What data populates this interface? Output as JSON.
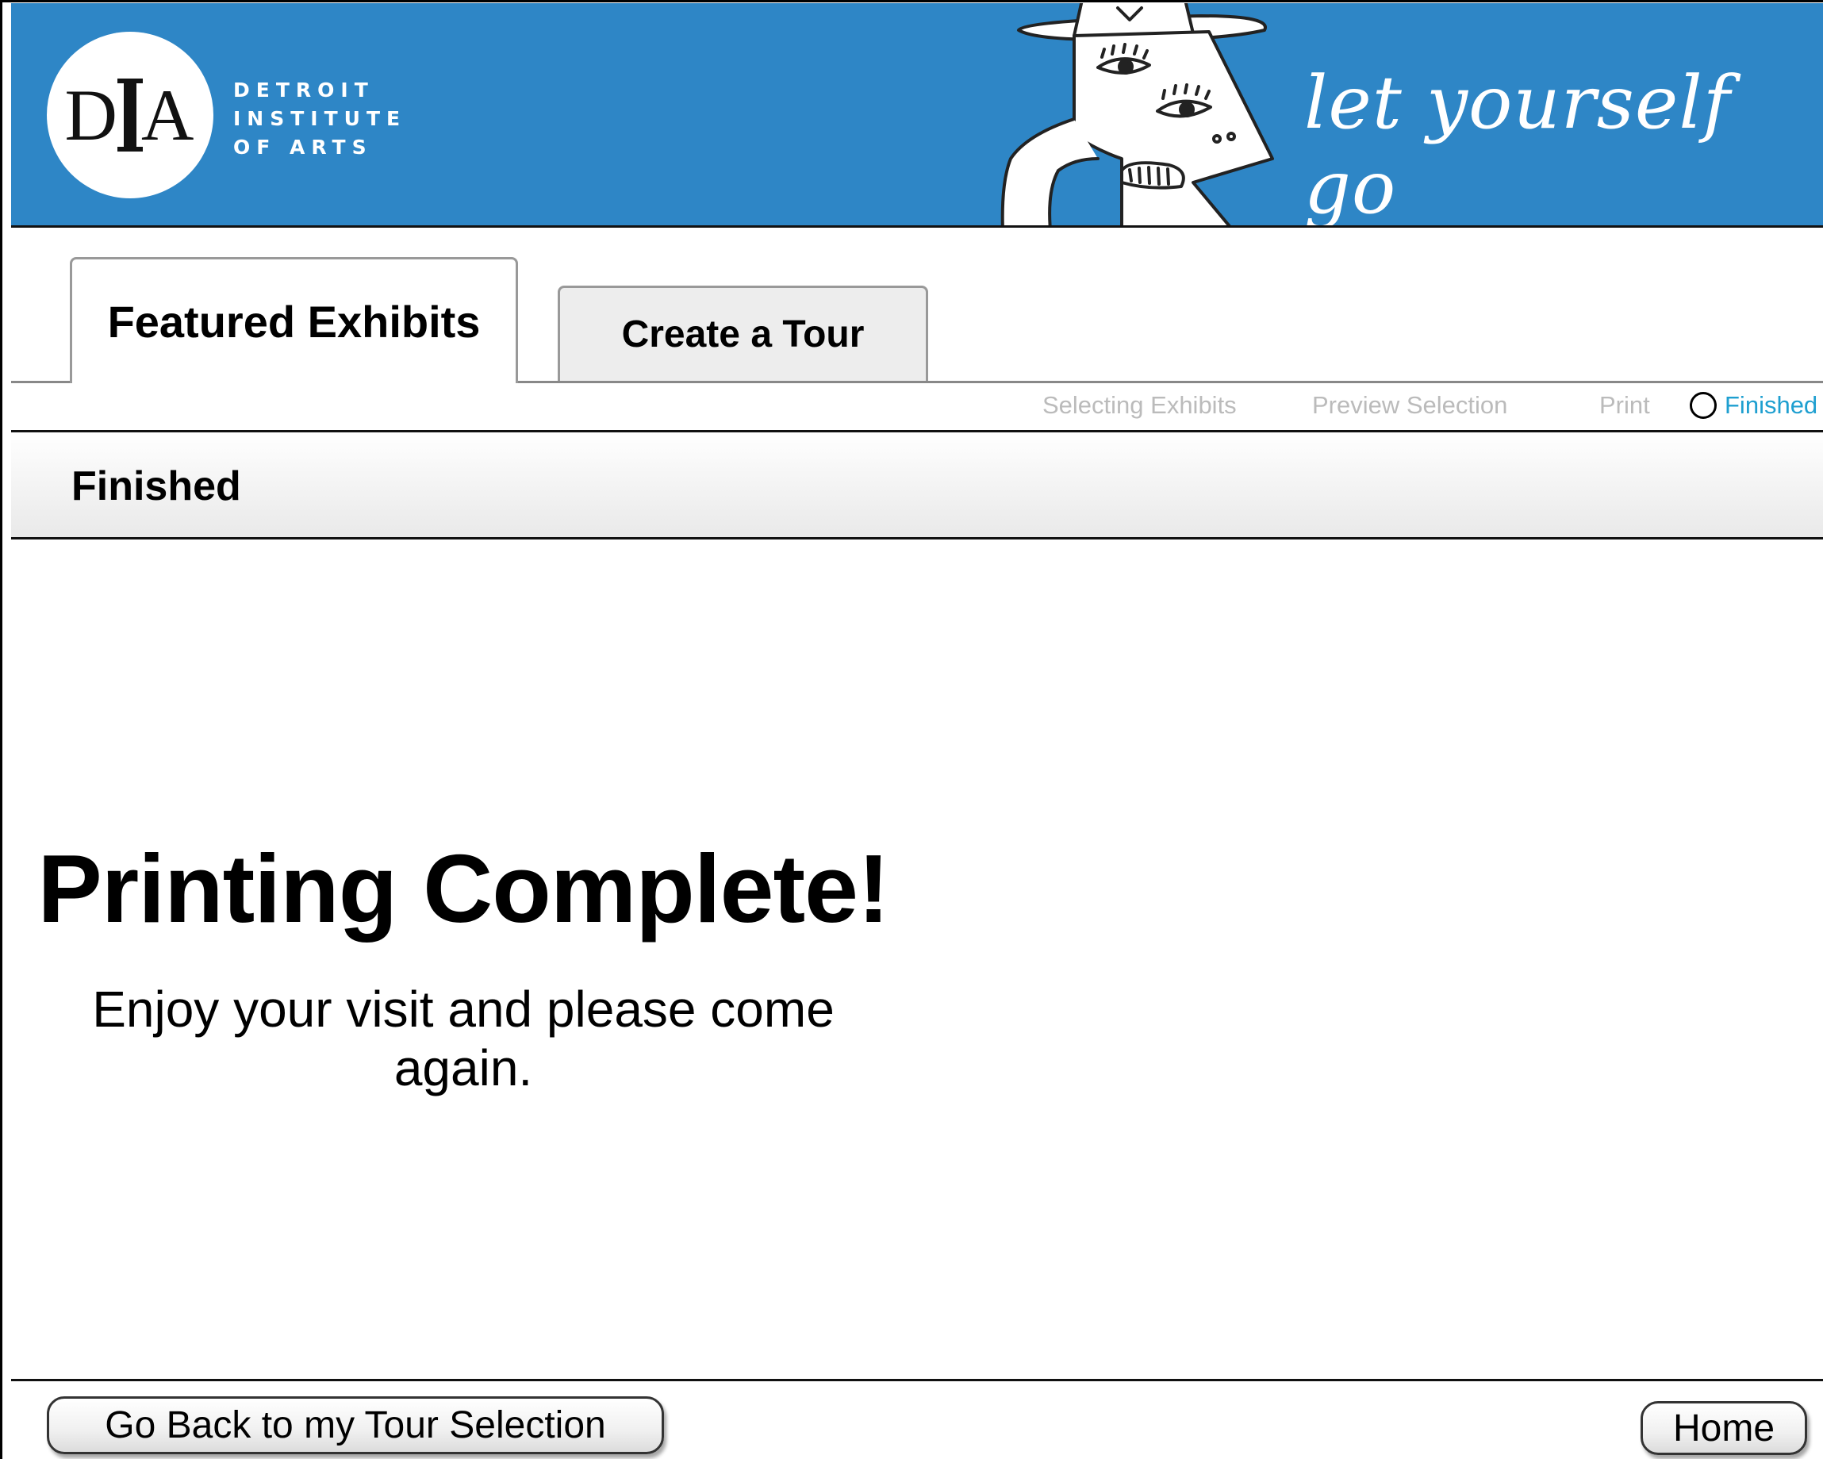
{
  "header": {
    "logo_letters_left": "D",
    "logo_letters_right": "A",
    "logo_text_lines": [
      "DETROIT",
      "INSTITUTE",
      "OF ARTS"
    ],
    "tagline": "let yourself go",
    "illustration": "face-with-hat-illustration"
  },
  "tabs": [
    {
      "label": "Featured Exhibits",
      "active": true
    },
    {
      "label": "Create a Tour",
      "active": false
    }
  ],
  "steps": [
    {
      "label": "Selecting Exhibits",
      "state": "inactive"
    },
    {
      "label": "Preview Selection",
      "state": "inactive"
    },
    {
      "label": "Print",
      "state": "inactive"
    },
    {
      "label": "Finished",
      "state": "current"
    }
  ],
  "section": {
    "title": "Finished"
  },
  "main": {
    "headline": "Printing Complete!",
    "message": "Enjoy your visit and please come again."
  },
  "footer": {
    "back_label": "Go Back to my Tour Selection",
    "home_label": "Home"
  },
  "colors": {
    "banner_blue": "#2e86c6",
    "step_active": "#1e9fd0",
    "step_inactive": "#bbbbbb"
  }
}
